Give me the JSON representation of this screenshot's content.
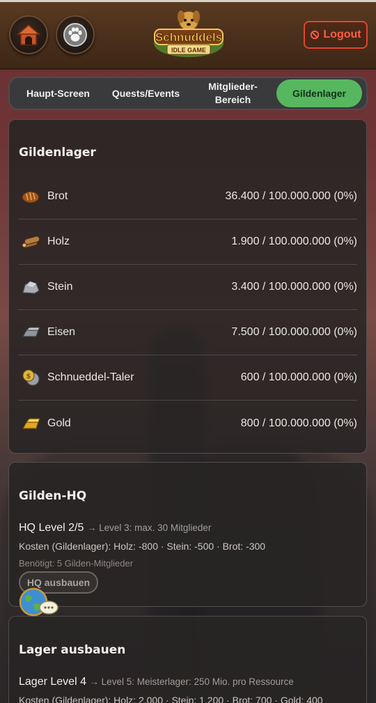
{
  "header": {
    "home_icon": "doghouse-icon",
    "paw_icon": "paw-icon",
    "logo_title": "Schnüddels",
    "logo_subtitle": "IDLE GAME",
    "logout_label": "Logout"
  },
  "tabs": [
    {
      "label": "Haupt-Screen",
      "active": false
    },
    {
      "label": "Quests/Events",
      "active": false
    },
    {
      "label": "Mitglieder-\nBereich",
      "active": false
    },
    {
      "label": "Gildenlager",
      "active": true
    }
  ],
  "storage": {
    "title": "Gildenlager",
    "resources": [
      {
        "name": "Brot",
        "value": "36.400 / 100.000.000 (0%)",
        "icon": "bread-icon"
      },
      {
        "name": "Holz",
        "value": "1.900 / 100.000.000 (0%)",
        "icon": "wood-icon"
      },
      {
        "name": "Stein",
        "value": "3.400 / 100.000.000 (0%)",
        "icon": "stone-icon"
      },
      {
        "name": "Eisen",
        "value": "7.500 / 100.000.000 (0%)",
        "icon": "iron-icon"
      },
      {
        "name": "Schnueddel-Taler",
        "value": "600 / 100.000.000 (0%)",
        "icon": "coin-icon"
      },
      {
        "name": "Gold",
        "value": "800 / 100.000.000 (0%)",
        "icon": "gold-icon"
      }
    ]
  },
  "hq": {
    "title": "Gilden-HQ",
    "level": "HQ Level 2/5",
    "next": "→ Level 3: max. 30 Mitglieder",
    "cost": "Kosten (Gildenlager): Holz: -800 · Stein: -500 · Brot: -300",
    "requirement": "Benötigt: 5 Gilden-Mitglieder",
    "button_label": "HQ ausbauen"
  },
  "lager": {
    "title": "Lager ausbauen",
    "level": "Lager Level 4",
    "next": "→ Level 5: Meisterlager: 250 Mio. pro Ressource",
    "cost": "Kosten (Gildenlager): Holz: 2.000 · Stein: 1.200 · Brot: 700 · Gold: 400"
  },
  "chat": {
    "icon": "globe-chat-icon"
  },
  "colors": {
    "accent_green": "#57b75f",
    "logout_red": "#e0452e"
  }
}
